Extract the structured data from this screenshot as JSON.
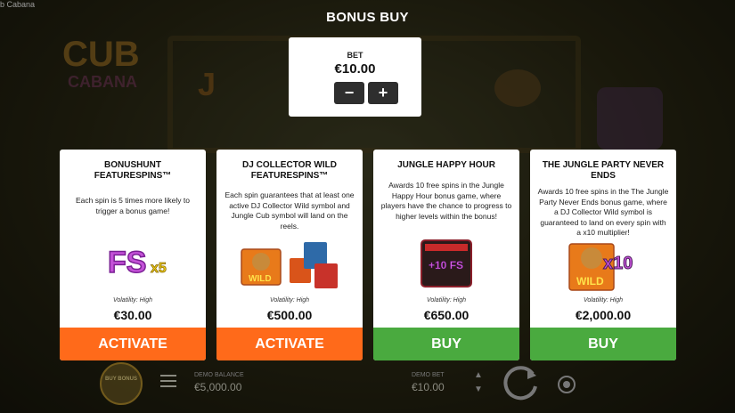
{
  "window": {
    "tab_title": "b Cabana"
  },
  "background": {
    "logo_text_top": "CUB",
    "logo_text_bottom": "CABANA",
    "reel_symbol": "J"
  },
  "header": {
    "title": "BONUS BUY"
  },
  "bet": {
    "label": "BET",
    "value": "€10.00",
    "minus_icon": "minus-icon",
    "plus_icon": "plus-icon"
  },
  "cards": [
    {
      "title": "BONUSHUNT FEATURESPINS™",
      "description": "Each spin is 5 times more likely to trigger a bonus game!",
      "art_text": "FS",
      "art_multiplier": "x5",
      "volatility": "Volatility: High",
      "price": "€30.00",
      "button": "ACTIVATE",
      "button_color": "#ff6a1a"
    },
    {
      "title": "DJ COLLECTOR WILD FEATURESPINS™",
      "description": "Each spin guarantees that at least one active DJ Collector Wild symbol and Jungle Cub symbol will land on the reels.",
      "art_text": "WILD",
      "volatility": "Volatility: High",
      "price": "€500.00",
      "button": "ACTIVATE",
      "button_color": "#ff6a1a"
    },
    {
      "title": "JUNGLE HAPPY HOUR",
      "description": "Awards 10 free spins in the Jungle Happy Hour bonus game, where players have the chance to progress to higher levels within the bonus!",
      "art_text": "+10 FS",
      "volatility": "Volatility: High",
      "price": "€650.00",
      "button": "BUY",
      "button_color": "#4aaa3f"
    },
    {
      "title": "THE JUNGLE PARTY NEVER ENDS",
      "description": "Awards 10 free spins in the The Jungle Party Never Ends bonus game, where a DJ Collector Wild symbol is guaranteed to land on every spin with a x10 multiplier!",
      "art_text": "WILD",
      "art_multiplier": "x10",
      "volatility": "Volatility: High",
      "price": "€2,000.00",
      "button": "BUY",
      "button_color": "#4aaa3f"
    }
  ],
  "bottom": {
    "buy_bonus_label": "BUY BONUS",
    "balance_label": "DEMO BALANCE",
    "balance_value": "€5,000.00",
    "bet_label": "DEMO BET",
    "bet_value": "€10.00"
  }
}
